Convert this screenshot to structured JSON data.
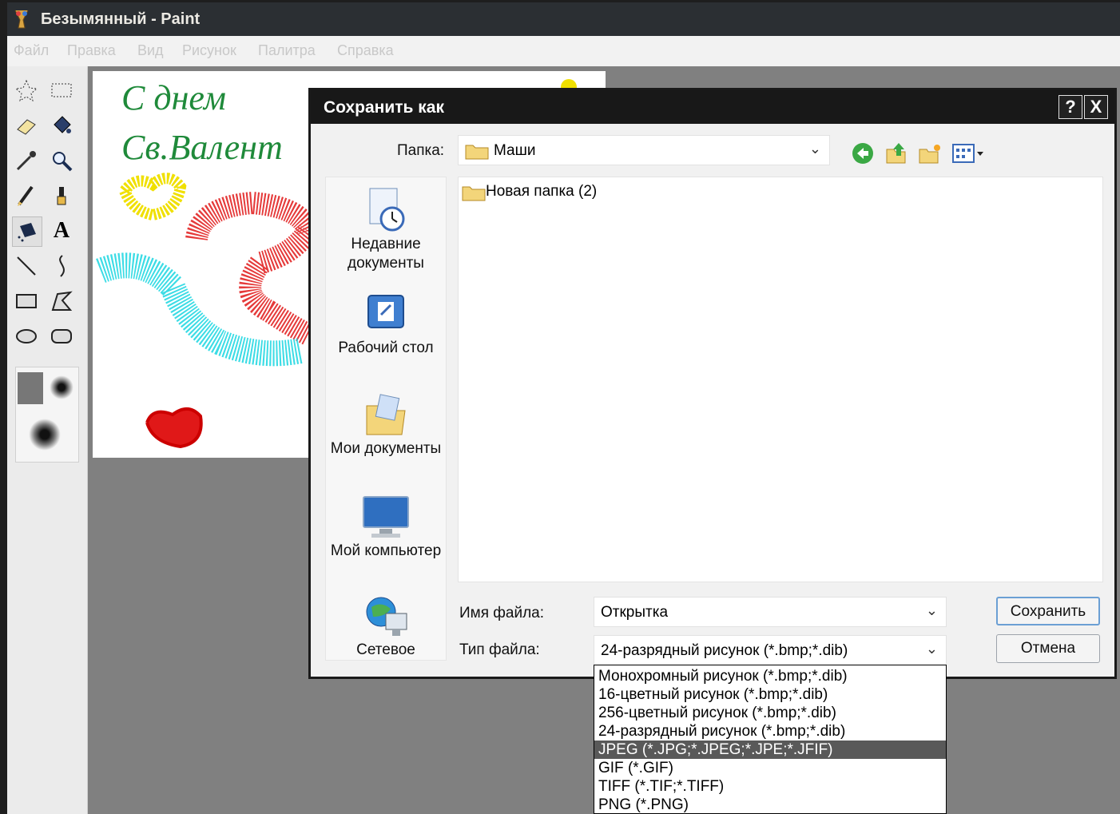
{
  "paint": {
    "title": "Безымянный - Paint",
    "menu": [
      "Файл",
      "Правка",
      "Вид",
      "Рисунок",
      "Палитра",
      "Справка"
    ],
    "canvas_text": [
      "С днем",
      "Св.Валент"
    ],
    "tools": [
      "free-select-icon",
      "rect-select-icon",
      "eraser-icon",
      "fill-icon",
      "picker-icon",
      "magnifier-icon",
      "pencil-icon",
      "brush-icon",
      "airbrush-icon",
      "text-icon",
      "line-icon",
      "curve-icon",
      "rectangle-icon",
      "polygon-icon",
      "ellipse-icon",
      "rounded-rect-icon"
    ]
  },
  "dialog": {
    "title": "Сохранить как",
    "help_label": "?",
    "close_label": "X",
    "folder_label": "Папка:",
    "folder_value": "Маши",
    "places": [
      "Недавние документы",
      "Рабочий стол",
      "Мои документы",
      "Мой компьютер",
      "Сетевое"
    ],
    "files": [
      "Новая папка (2)"
    ],
    "filename_label": "Имя файла:",
    "filename_value": "Открытка",
    "filetype_label": "Тип файла:",
    "filetype_value": "24-разрядный рисунок (*.bmp;*.dib)",
    "save_button": "Сохранить",
    "cancel_button": "Отмена"
  },
  "filetype_options": [
    "Монохромный рисунок (*.bmp;*.dib)",
    "16-цветный рисунок (*.bmp;*.dib)",
    "256-цветный рисунок (*.bmp;*.dib)",
    "24-разрядный рисунок (*.bmp;*.dib)",
    "JPEG (*.JPG;*.JPEG;*.JPE;*.JFIF)",
    "GIF (*.GIF)",
    "TIFF (*.TIF;*.TIFF)",
    "PNG (*.PNG)"
  ],
  "selected_option_index": 4,
  "colors": {
    "dialog_title_bg": "#181818",
    "selected_option_bg": "#595959",
    "canvas_text": "#1f8a3a"
  }
}
